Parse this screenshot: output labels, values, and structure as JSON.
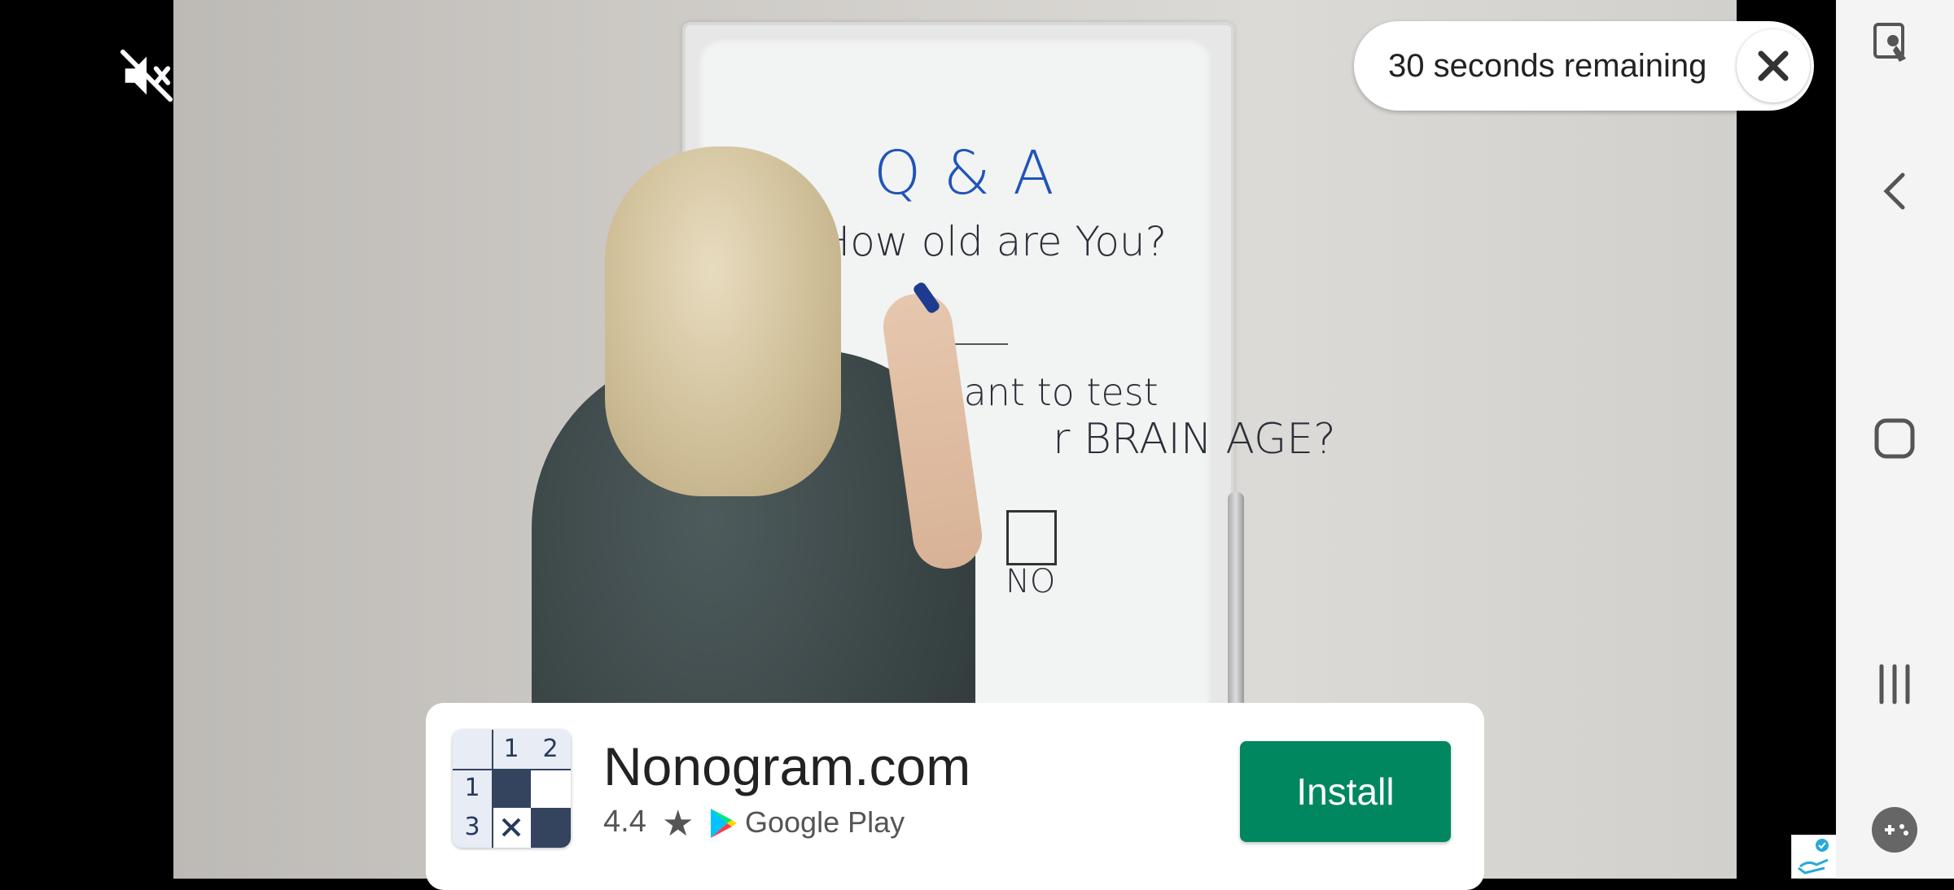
{
  "video": {
    "whiteboard": {
      "heading": "Q & A",
      "question1": "1. How old are You?",
      "question2_line1": "Do Yo want to test",
      "question2_line2": "r BRAIN AGE?",
      "option_no": "NO"
    },
    "mute_icon": "volume-off-icon"
  },
  "timer": {
    "text": "30 seconds remaining",
    "close_icon": "close-icon"
  },
  "ad": {
    "app_name": "Nonogram.com",
    "rating": "4.4",
    "store": "Google Play",
    "install_label": "Install",
    "icon_grid": {
      "col_headers": [
        "1",
        "2"
      ],
      "row_headers": [
        "1",
        "3"
      ]
    }
  },
  "nav": {
    "items": [
      "screen-lock-icon",
      "back-icon",
      "home-icon",
      "recents-icon",
      "game-tools-icon"
    ]
  },
  "colors": {
    "install": "#01875f",
    "nav_bg": "#f4f4f4"
  }
}
